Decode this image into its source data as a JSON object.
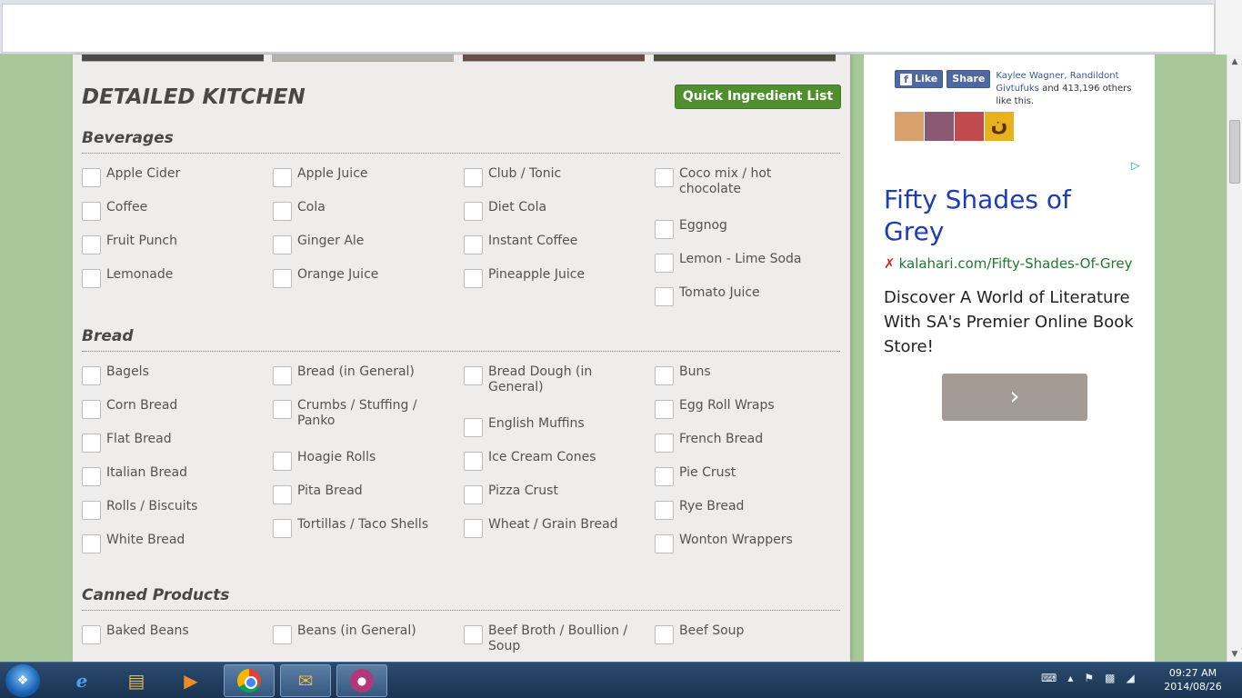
{
  "page": {
    "title": "DETAILED KITCHEN",
    "quick_button": "Quick Ingredient List"
  },
  "sections": [
    {
      "title": "Beverages",
      "columns": [
        [
          "Apple Cider",
          "Coffee",
          "Fruit Punch",
          "Lemonade"
        ],
        [
          "Apple Juice",
          "Cola",
          "Ginger Ale",
          "Orange Juice"
        ],
        [
          "Club / Tonic",
          "Diet Cola",
          "Instant Coffee",
          "Pineapple Juice"
        ],
        [
          "Coco mix / hot chocolate",
          "Eggnog",
          "Lemon - Lime Soda",
          "Tomato Juice"
        ]
      ]
    },
    {
      "title": "Bread",
      "columns": [
        [
          "Bagels",
          "Corn Bread",
          "Flat Bread",
          "Italian Bread",
          "Rolls / Biscuits",
          "White Bread"
        ],
        [
          "Bread (in General)",
          "Crumbs / Stuffing / Panko",
          "Hoagie Rolls",
          "Pita Bread",
          "Tortillas / Taco Shells"
        ],
        [
          "Bread Dough (in General)",
          "English Muffins",
          "Ice Cream Cones",
          "Pizza Crust",
          "Wheat / Grain Bread"
        ],
        [
          "Buns",
          "Egg Roll Wraps",
          "French Bread",
          "Pie Crust",
          "Rye Bread",
          "Wonton Wrappers"
        ]
      ]
    },
    {
      "title": "Canned Products",
      "columns": [
        [
          "Baked Beans"
        ],
        [
          "Beans (in General)"
        ],
        [
          "Beef Broth / Boullion / Soup"
        ],
        [
          "Beef Soup"
        ]
      ]
    }
  ],
  "facebook": {
    "like_label": "Like",
    "share_label": "Share",
    "names": "Kaylee Wagner, Randildont Givtufuks",
    "suffix": "and 413,196 others like this.",
    "avatar4_glyph": "ن"
  },
  "ad": {
    "title": "Fifty Shades of Grey",
    "url": "kalahari.com/Fifty-Shades-Of-Grey",
    "description": "Discover A World of Literature With SA's Premier Online Book Store!",
    "next_glyph": "›"
  },
  "taskbar": {
    "time": "09:27 AM",
    "date": "2014/08/26"
  },
  "colors": {
    "accent_green": "#4f8f2d",
    "ad_title_blue": "#1e3cb8",
    "ad_url_green": "#1f7a2c",
    "facebook_blue": "#4e69a2"
  }
}
